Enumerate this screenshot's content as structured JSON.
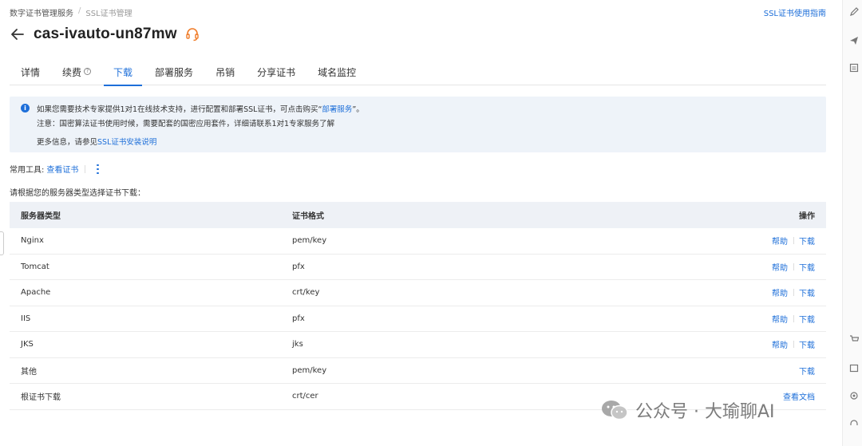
{
  "breadcrumb": [
    "数字证书管理服务",
    "SSL证书管理"
  ],
  "guide_link": "SSL证书使用指南",
  "title": "cas-ivauto-un87mw",
  "tabs": [
    "详情",
    "续费",
    "下载",
    "部署服务",
    "吊销",
    "分享证书",
    "域名监控"
  ],
  "active_tab": "下载",
  "notice": {
    "line1_prefix": "如果您需要技术专家提供1对1在线技术支持，进行配置和部署SSL证书，可点击购买“",
    "line1_link": "部署服务",
    "line1_suffix": "”。",
    "line2": "注意：国密算法证书使用时候，需要配套的国密应用套件，详细请联系1对1专家服务了解",
    "line3_prefix": "更多信息，请参见",
    "line3_link": "SSL证书安装说明"
  },
  "tools": {
    "label": "常用工具:",
    "view_cert": "查看证书"
  },
  "hint": "请根据您的服务器类型选择证书下载：",
  "table": {
    "headers": [
      "服务器类型",
      "证书格式",
      "操作"
    ],
    "rows": [
      {
        "server": "Nginx",
        "format": "pem/key",
        "help": "帮助",
        "download": "下载"
      },
      {
        "server": "Tomcat",
        "format": "pfx",
        "help": "帮助",
        "download": "下载"
      },
      {
        "server": "Apache",
        "format": "crt/key",
        "help": "帮助",
        "download": "下载"
      },
      {
        "server": "IIS",
        "format": "pfx",
        "help": "帮助",
        "download": "下载"
      },
      {
        "server": "JKS",
        "format": "jks",
        "help": "帮助",
        "download": "下载"
      },
      {
        "server": "其他",
        "format": "pem/key",
        "help": "",
        "download": "下载"
      },
      {
        "server": "根证书下载",
        "format": "crt/cer",
        "help": "",
        "download": "查看文档"
      }
    ]
  },
  "watermark": "公众号 · 大瑜聊AI",
  "colors": {
    "accent": "#1e6fd9",
    "notice_bg": "#eef3f9",
    "header_bg": "#eef1f6",
    "support_icon": "#f07c28"
  }
}
